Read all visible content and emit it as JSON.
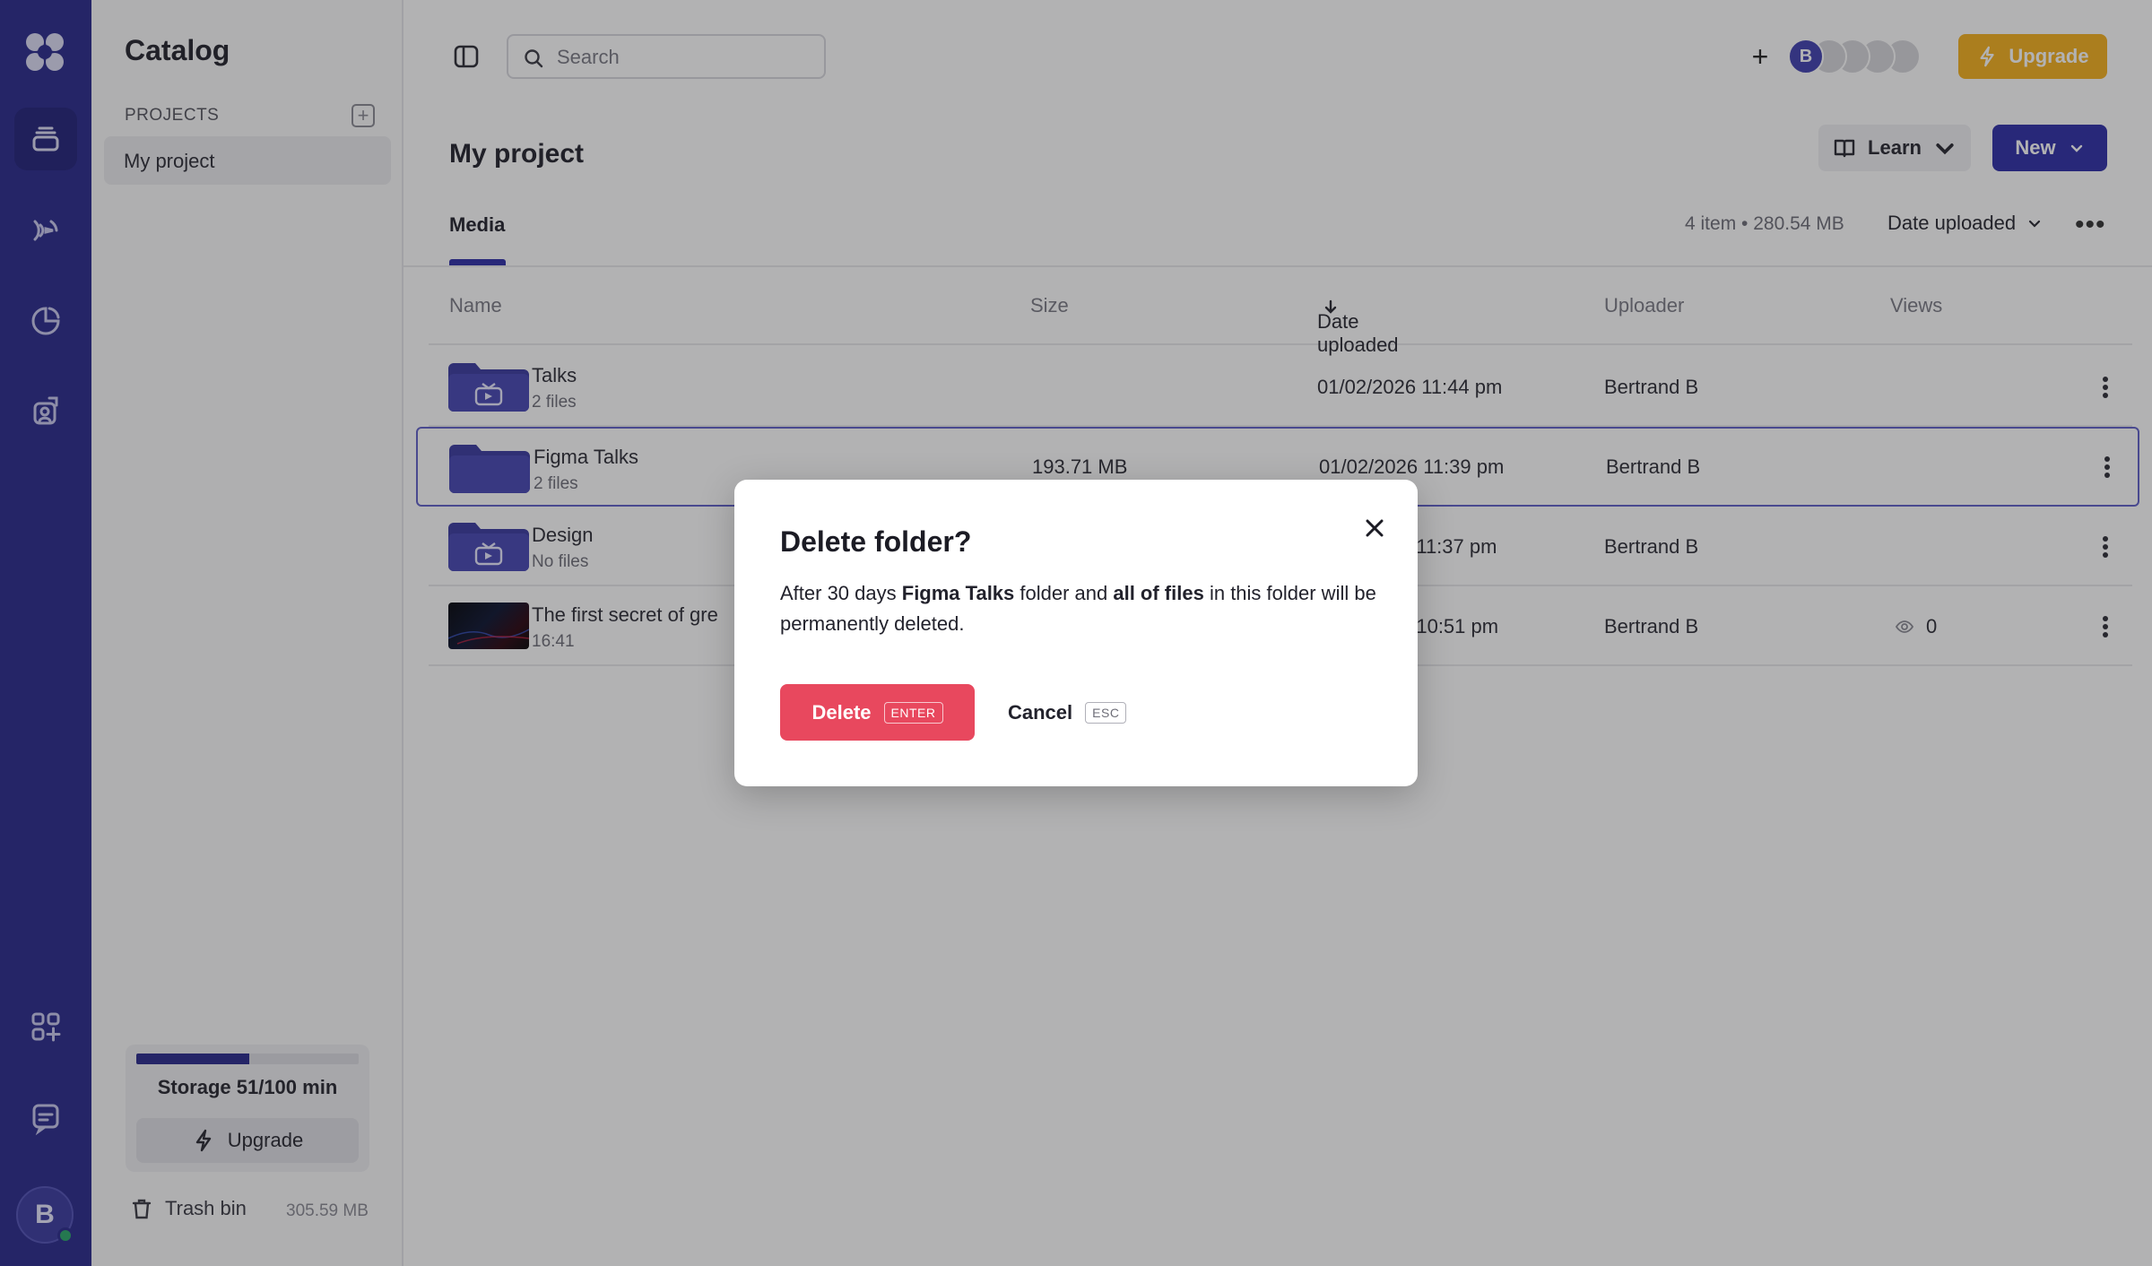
{
  "sidebar": {
    "title": "Catalog",
    "section_label": "PROJECTS",
    "projects": [
      {
        "label": "My project"
      }
    ],
    "storage": {
      "label": "Storage 51/100 min",
      "used_fraction": 0.51
    },
    "upgrade_label": "Upgrade",
    "trash": {
      "label": "Trash bin",
      "size": "305.59 MB"
    }
  },
  "rail": {
    "avatar_initial": "B",
    "icons": [
      "logo-icon",
      "library-icon",
      "podcast-icon",
      "analytics-icon",
      "presenter-icon",
      "apps-icon",
      "chat-icon"
    ]
  },
  "header": {
    "search_placeholder": "Search",
    "avatar_initial": "B",
    "upgrade_label": "Upgrade"
  },
  "page": {
    "title": "My project",
    "learn_label": "Learn",
    "new_label": "New",
    "tab": "Media",
    "items_summary": "4 item • 280.54 MB",
    "sort_label": "Date uploaded"
  },
  "table": {
    "columns": [
      "Name",
      "Size",
      "Date uploaded",
      "Uploader",
      "Views"
    ],
    "rows": [
      {
        "name": "Talks",
        "sub": "2 files",
        "size": "",
        "date": "01/02/2026 11:44 pm",
        "uploader": "Bertrand B",
        "views": "",
        "kind": "folder-video"
      },
      {
        "name": "Figma Talks",
        "sub": "2 files",
        "size": "193.71 MB",
        "date": "01/02/2026 11:39 pm",
        "uploader": "Bertrand B",
        "views": "",
        "kind": "folder"
      },
      {
        "name": "Design",
        "sub": "No files",
        "size": "",
        "date": "5 11:37 pm",
        "uploader": "Bertrand B",
        "views": "",
        "kind": "folder-video"
      },
      {
        "name": "The first secret of gre",
        "sub": "16:41",
        "size": "",
        "date": "5 10:51 pm",
        "uploader": "Bertrand B",
        "views": "0",
        "kind": "video"
      }
    ]
  },
  "modal": {
    "title": "Delete folder?",
    "body": {
      "pre": "After 30 days ",
      "folder_name": "Figma Talks",
      "mid": " folder and ",
      "emphasis": "all of files",
      "post": " in this folder will be permanently deleted."
    },
    "delete_label": "Delete",
    "delete_key": "ENTER",
    "cancel_label": "Cancel",
    "cancel_key": "ESC"
  },
  "colors": {
    "rail": "#2a2a8c",
    "accent": "#2e2ea8",
    "upgrade": "#f5b01e",
    "danger": "#e8485e",
    "folder": "#3b3ba0"
  }
}
